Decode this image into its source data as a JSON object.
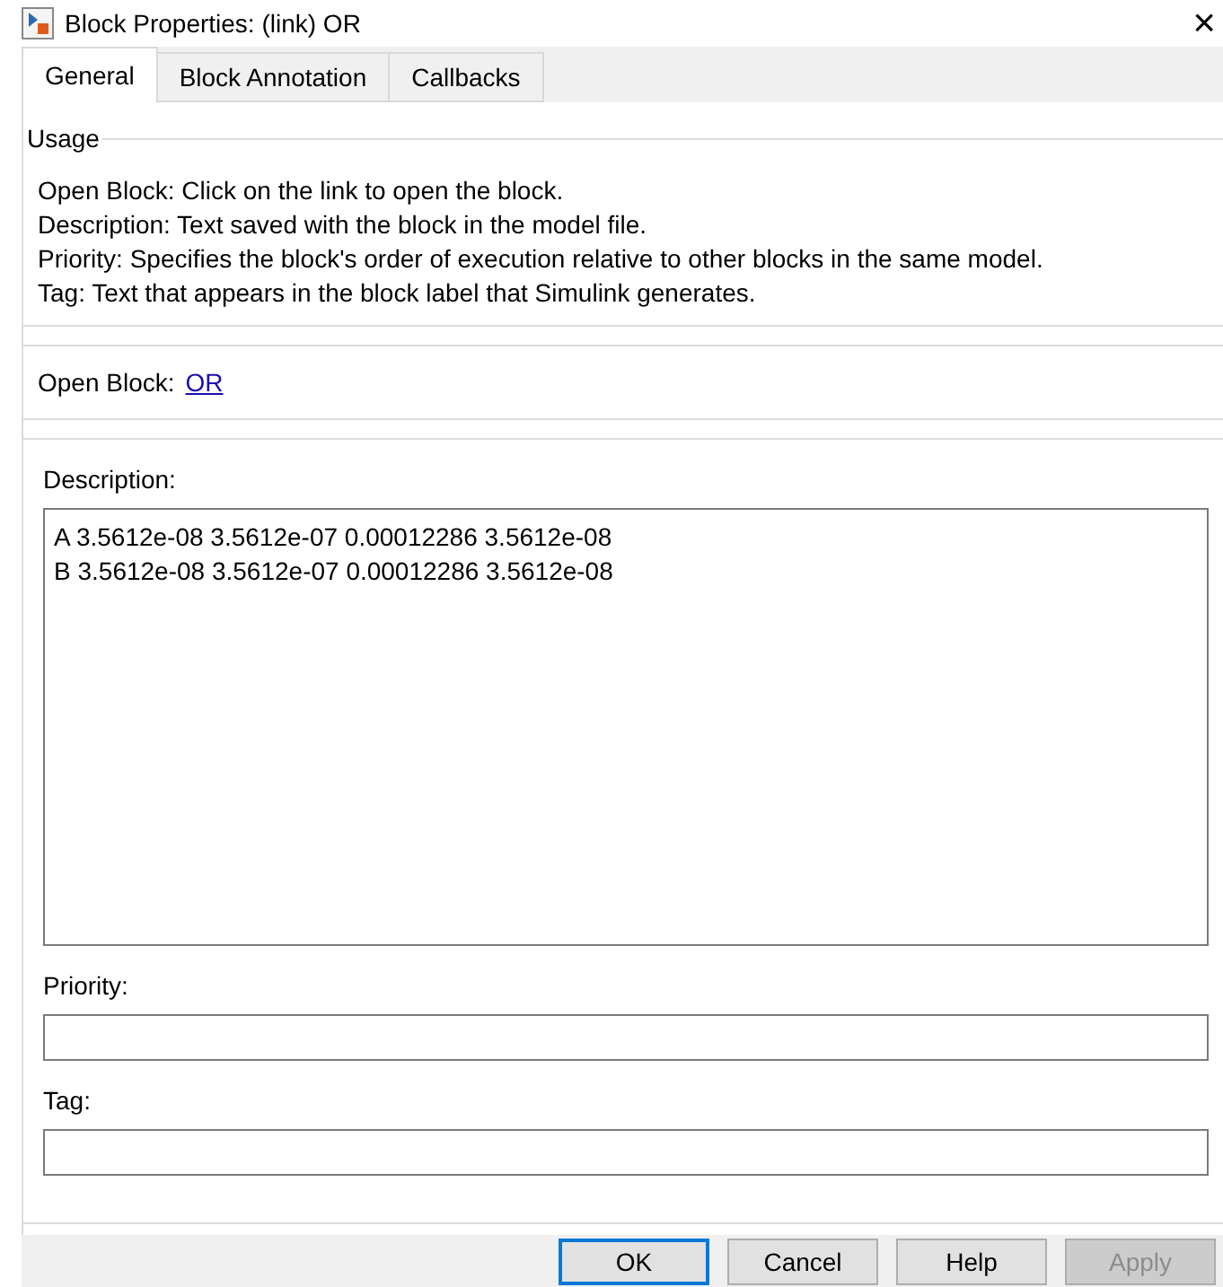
{
  "window": {
    "title": "Block Properties: (link) OR",
    "close": "×"
  },
  "tabs": [
    {
      "label": "General",
      "selected": true
    },
    {
      "label": "Block Annotation",
      "selected": false
    },
    {
      "label": "Callbacks",
      "selected": false
    }
  ],
  "usage": {
    "title": "Usage",
    "lines": [
      "Open Block: Click on the link to open the block.",
      "Description: Text saved with the block in the model file.",
      "Priority: Specifies the block's order of execution relative to other blocks in the same model.",
      "Tag: Text that appears in the block label that Simulink generates."
    ]
  },
  "open_block": {
    "label": "Open Block:",
    "link": "OR"
  },
  "description": {
    "label": "Description:",
    "value": "A 3.5612e-08 3.5612e-07 0.00012286 3.5612e-08\nB 3.5612e-08 3.5612e-07 0.00012286 3.5612e-08"
  },
  "priority": {
    "label": "Priority:"
  },
  "tag": {
    "label": "Tag:"
  },
  "buttons": [
    {
      "label": "OK",
      "default": true,
      "disabled": false
    },
    {
      "label": "Cancel",
      "default": false,
      "disabled": false
    },
    {
      "label": "Help",
      "default": false,
      "disabled": false
    },
    {
      "label": "Apply",
      "default": false,
      "disabled": true
    }
  ]
}
